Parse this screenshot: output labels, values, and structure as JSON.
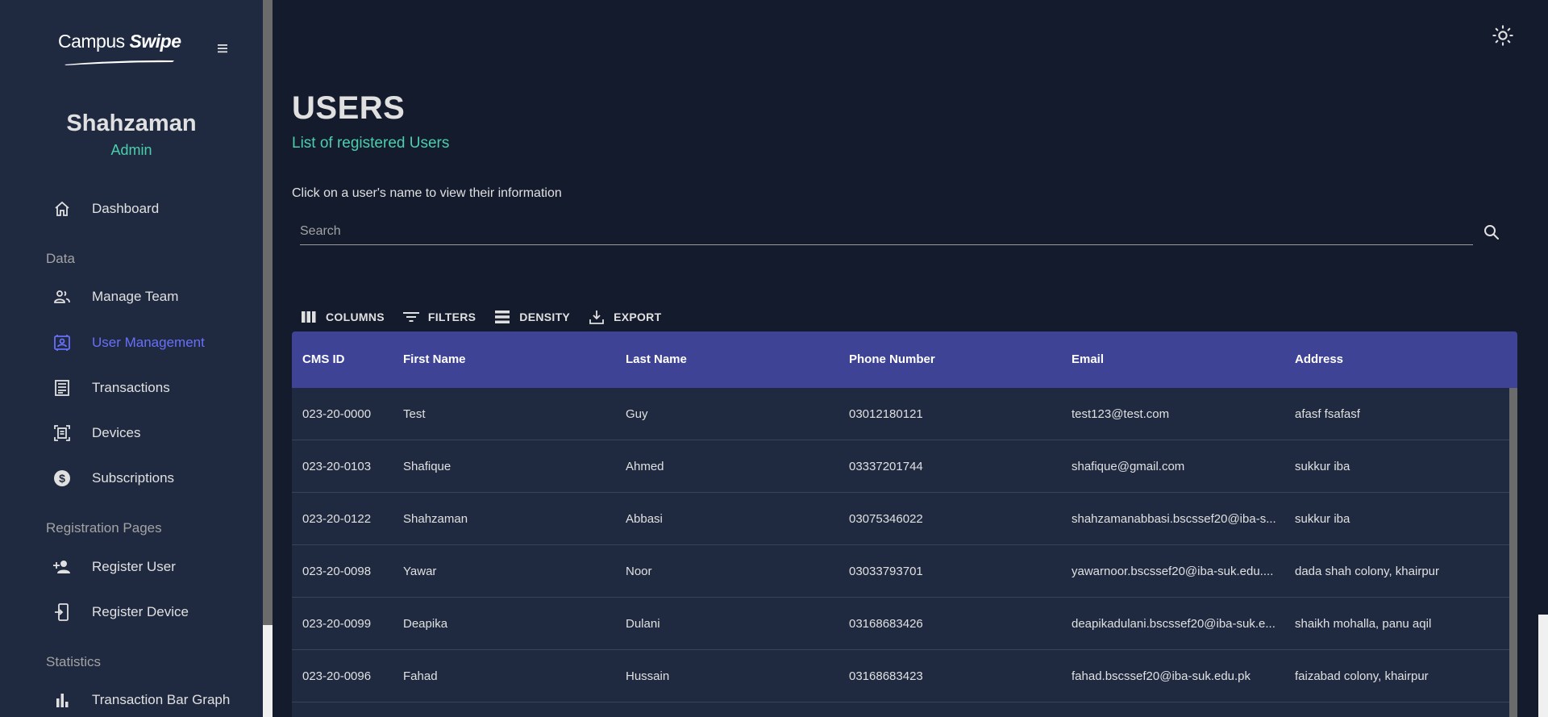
{
  "sidebar": {
    "logo": {
      "campus": "Campus",
      "swipe": "Swipe"
    },
    "menu_icon": "hamburger-icon",
    "profile": {
      "name": "Shahzaman",
      "role": "Admin"
    },
    "items": [
      {
        "label": "Dashboard",
        "icon": "home-icon"
      },
      {
        "label": "Manage Team",
        "icon": "people-icon"
      },
      {
        "label": "User Management",
        "icon": "contact-card-icon",
        "active": true
      },
      {
        "label": "Transactions",
        "icon": "receipt-list-icon"
      },
      {
        "label": "Devices",
        "icon": "document-scanner-icon"
      },
      {
        "label": "Subscriptions",
        "icon": "dollar-circle-icon"
      },
      {
        "label": "Register User",
        "icon": "person-add-icon"
      },
      {
        "label": "Register Device",
        "icon": "device-add-icon"
      },
      {
        "label": "Transaction Bar Graph",
        "icon": "bar-chart-icon"
      }
    ],
    "sections": [
      "Data",
      "Registration Pages",
      "Statistics"
    ]
  },
  "header": {
    "theme_icon": "sun-icon"
  },
  "main": {
    "title": "USERS",
    "subtitle": "List of registered Users",
    "hint": "Click on a user's name to view their information",
    "search": {
      "placeholder": "Search",
      "value": ""
    },
    "toolbar": {
      "columns": "COLUMNS",
      "filters": "FILTERS",
      "density": "DENSITY",
      "export": "EXPORT"
    }
  },
  "table": {
    "columns": [
      "CMS ID",
      "First Name",
      "Last Name",
      "Phone Number",
      "Email",
      "Address"
    ],
    "rows": [
      [
        "023-20-0000",
        "Test",
        "Guy",
        "03012180121",
        "test123@test.com",
        "afasf fsafasf"
      ],
      [
        "023-20-0103",
        "Shafique",
        "Ahmed",
        "03337201744",
        "shafique@gmail.com",
        "sukkur iba"
      ],
      [
        "023-20-0122",
        "Shahzaman",
        "Abbasi",
        "03075346022",
        "shahzamanabbasi.bscssef20@iba-s...",
        "sukkur iba"
      ],
      [
        "023-20-0098",
        "Yawar",
        "Noor",
        "03033793701",
        "yawarnoor.bscssef20@iba-suk.edu....",
        "dada shah colony, khairpur"
      ],
      [
        "023-20-0099",
        "Deapika",
        "Dulani",
        "03168683426",
        "deapikadulani.bscssef20@iba-suk.e...",
        "shaikh mohalla, panu aqil"
      ],
      [
        "023-20-0096",
        "Fahad",
        "Hussain",
        "03168683423",
        "fahad.bscssef20@iba-suk.edu.pk",
        "faizabad colony, khairpur"
      ]
    ]
  }
}
